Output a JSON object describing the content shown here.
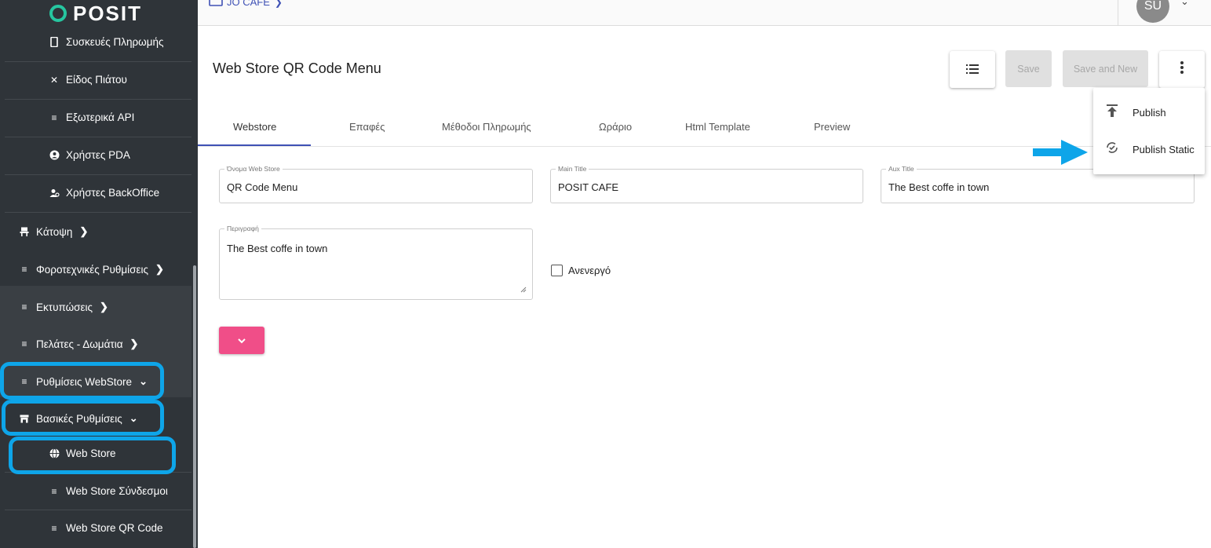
{
  "app": {
    "logo_text": "POSIT"
  },
  "topbar": {
    "store_name": "JO CAFE",
    "avatar_initials": "SU"
  },
  "sidebar": {
    "items": [
      {
        "label": "Συσκευές Πληρωμής",
        "icon": "phone-icon"
      },
      {
        "label": "Είδος Πιάτου",
        "icon": "utensils-icon"
      },
      {
        "label": "Εξωτερικά API",
        "icon": "list-icon"
      },
      {
        "label": "Χρήστες PDA",
        "icon": "user-circle-icon"
      },
      {
        "label": "Χρήστες BackOffice",
        "icon": "users-icon"
      },
      {
        "label": "Κάτοψη",
        "icon": "chair-icon"
      },
      {
        "label": "Φοροτεχνικές Ρυθμίσεις",
        "icon": "list-icon"
      },
      {
        "label": "Εκτυπώσεις",
        "icon": "list-icon"
      },
      {
        "label": "Πελάτες - Δωμάτια",
        "icon": "list-icon"
      },
      {
        "label": "Ρυθμίσεις WebStore",
        "icon": "list-icon"
      },
      {
        "label": "Βασικές Ρυθμίσεις",
        "icon": "store-icon"
      },
      {
        "label": "Web Store",
        "icon": "globe-icon"
      },
      {
        "label": "Web Store Σύνδεσμοι",
        "icon": "list-icon"
      },
      {
        "label": "Web Store QR Code",
        "icon": "list-icon"
      }
    ]
  },
  "header": {
    "title": "Web Store QR Code Menu",
    "save_label": "Save",
    "save_new_label": "Save and New"
  },
  "tabs": [
    "Webstore",
    "Επαφές",
    "Μέθοδοι Πληρωμής",
    "Ωράριο",
    "Html Template",
    "Preview"
  ],
  "menu": {
    "items": [
      {
        "label": "Publish",
        "icon": "upload-icon"
      },
      {
        "label": "Publish Static",
        "icon": "sync-icon"
      }
    ]
  },
  "form": {
    "webstore_name_label": "Όνομα Web Store",
    "webstore_name_value": "QR Code Menu",
    "main_title_label": "Main Title",
    "main_title_value": "POSIT CAFE",
    "aux_title_label": "Aux Title",
    "aux_title_value": "The Best coffe in town",
    "description_label": "Περιγραφή",
    "description_value": "The Best coffe in town",
    "inactive_label": "Ανενεργό"
  },
  "colors": {
    "sidebar_bg": "#2f3439",
    "accent": "#3f51b5",
    "highlight": "#0ea5e9",
    "pink": "#f04e88"
  }
}
